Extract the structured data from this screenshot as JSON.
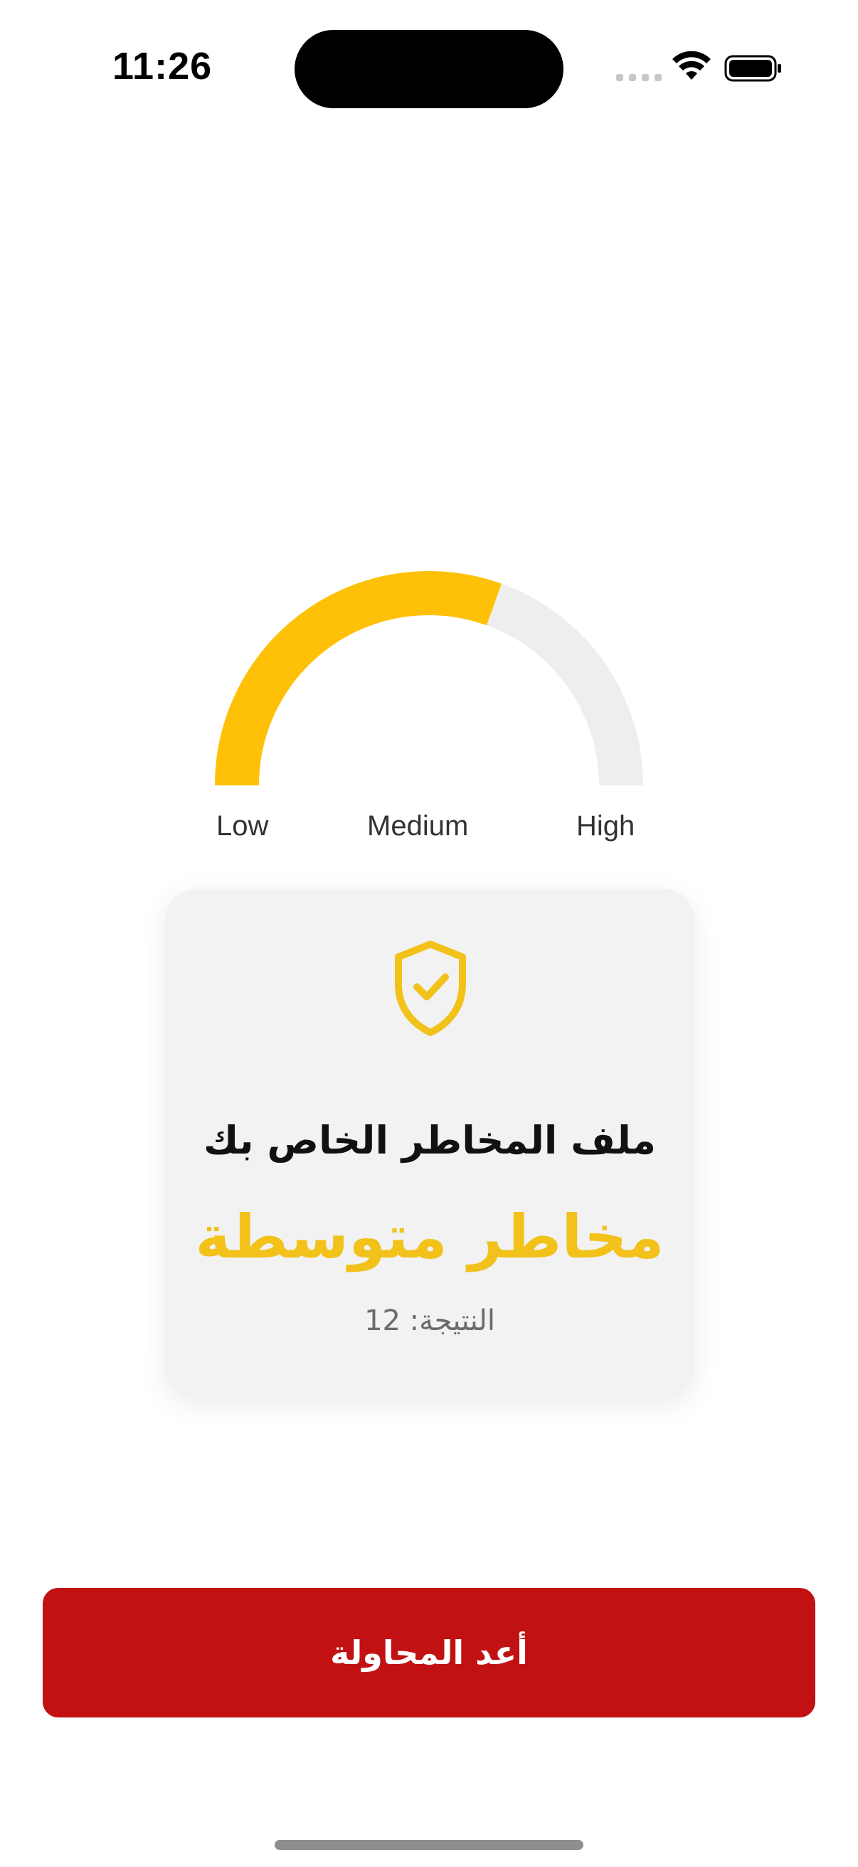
{
  "status_bar": {
    "time": "11:26"
  },
  "gauge": {
    "labels": {
      "low": "Low",
      "medium": "Medium",
      "high": "High"
    },
    "fill_fraction": 0.61,
    "fill_color": "#FFC107",
    "track_color": "#EEEEEE"
  },
  "card": {
    "icon": "shield-check-icon",
    "title": "ملف المخاطر الخاص بك",
    "level": "مخاطر متوسطة",
    "score": "النتيجة: 12",
    "level_color": "#F2C21A"
  },
  "actions": {
    "retry_label": "أعد المحاولة",
    "retry_color": "#C21113"
  }
}
